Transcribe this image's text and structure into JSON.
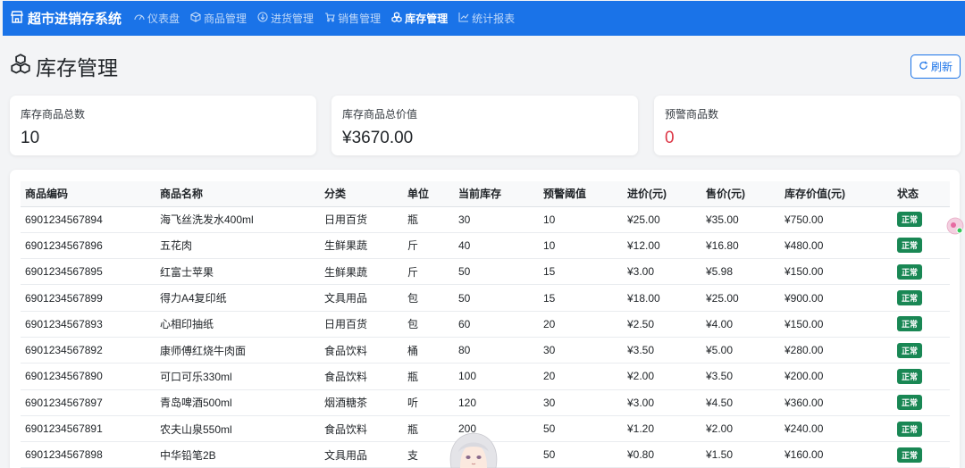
{
  "app": {
    "title": "超市进销存系统",
    "nav": [
      {
        "label": "仪表盘",
        "icon": "dashboard-icon",
        "active": false
      },
      {
        "label": "商品管理",
        "icon": "box-icon",
        "active": false
      },
      {
        "label": "进货管理",
        "icon": "download-icon",
        "active": false
      },
      {
        "label": "销售管理",
        "icon": "cart-icon",
        "active": false
      },
      {
        "label": "库存管理",
        "icon": "boxes-icon",
        "active": true
      },
      {
        "label": "统计报表",
        "icon": "chart-icon",
        "active": false
      }
    ]
  },
  "page": {
    "title": "库存管理",
    "refresh_label": "刷新"
  },
  "stats": [
    {
      "label": "库存商品总数",
      "value": "10"
    },
    {
      "label": "库存商品总价值",
      "value": "¥3670.00"
    },
    {
      "label": "预警商品数",
      "value": "0"
    }
  ],
  "table": {
    "headers": [
      "商品编码",
      "商品名称",
      "分类",
      "单位",
      "当前库存",
      "预警阈值",
      "进价(元)",
      "售价(元)",
      "库存价值(元)",
      "状态"
    ],
    "rows": [
      [
        "6901234567894",
        "海飞丝洗发水400ml",
        "日用百货",
        "瓶",
        "30",
        "10",
        "¥25.00",
        "¥35.00",
        "¥750.00",
        "正常"
      ],
      [
        "6901234567896",
        "五花肉",
        "生鲜果蔬",
        "斤",
        "40",
        "10",
        "¥12.00",
        "¥16.80",
        "¥480.00",
        "正常"
      ],
      [
        "6901234567895",
        "红富士苹果",
        "生鲜果蔬",
        "斤",
        "50",
        "15",
        "¥3.00",
        "¥5.98",
        "¥150.00",
        "正常"
      ],
      [
        "6901234567899",
        "得力A4复印纸",
        "文具用品",
        "包",
        "50",
        "15",
        "¥18.00",
        "¥25.00",
        "¥900.00",
        "正常"
      ],
      [
        "6901234567893",
        "心相印抽纸",
        "日用百货",
        "包",
        "60",
        "20",
        "¥2.50",
        "¥4.00",
        "¥150.00",
        "正常"
      ],
      [
        "6901234567892",
        "康师傅红烧牛肉面",
        "食品饮料",
        "桶",
        "80",
        "30",
        "¥3.50",
        "¥5.00",
        "¥280.00",
        "正常"
      ],
      [
        "6901234567890",
        "可口可乐330ml",
        "食品饮料",
        "瓶",
        "100",
        "20",
        "¥2.00",
        "¥3.50",
        "¥200.00",
        "正常"
      ],
      [
        "6901234567897",
        "青岛啤酒500ml",
        "烟酒糖茶",
        "听",
        "120",
        "30",
        "¥3.00",
        "¥4.50",
        "¥360.00",
        "正常"
      ],
      [
        "6901234567891",
        "农夫山泉550ml",
        "食品饮料",
        "瓶",
        "200",
        "50",
        "¥1.20",
        "¥2.00",
        "¥240.00",
        "正常"
      ],
      [
        "6901234567898",
        "中华铅笔2B",
        "文具用品",
        "支",
        "",
        "50",
        "¥0.80",
        "¥1.50",
        "¥160.00",
        "正常"
      ]
    ]
  },
  "colors": {
    "primary": "#1a73e8",
    "success": "#198754",
    "danger": "#dc3545"
  }
}
